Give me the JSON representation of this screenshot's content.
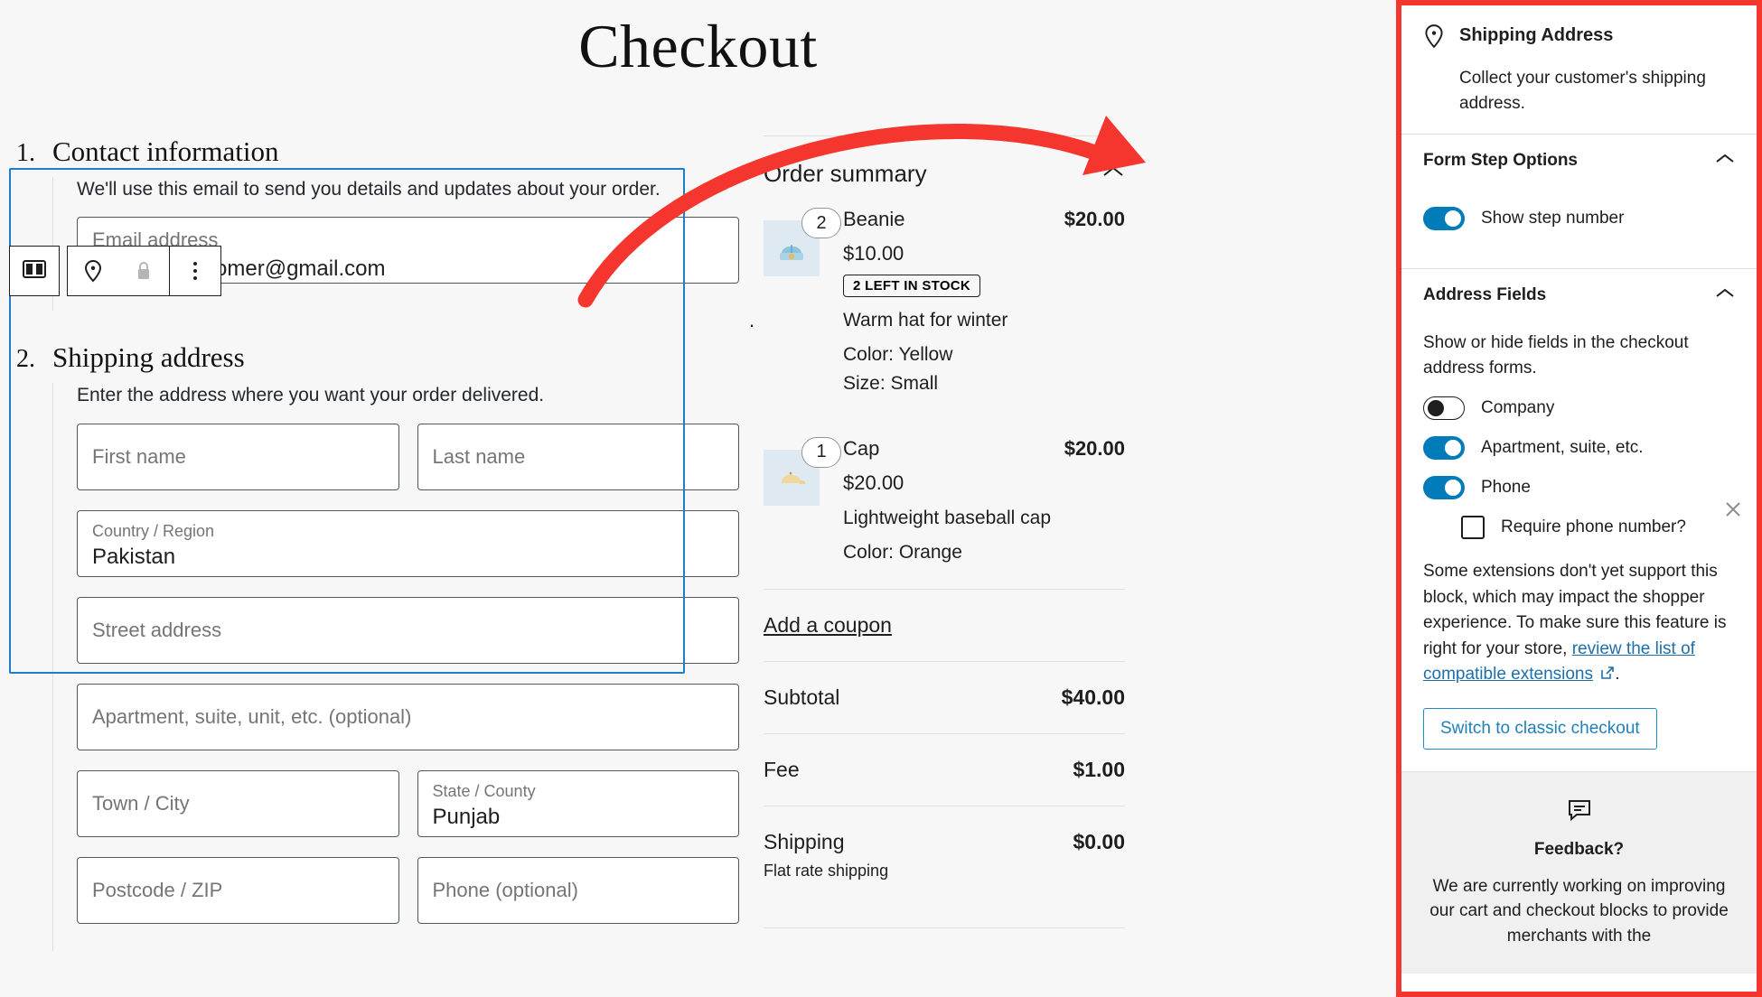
{
  "page": {
    "title": "Checkout"
  },
  "steps": [
    {
      "number": "1.",
      "title": "Contact information",
      "description": "We'll use this email to send you details and updates about your order.",
      "email_label": "Email address",
      "email_value": "surprise.customer@gmail.com"
    },
    {
      "number": "2.",
      "title": "Shipping address",
      "description": "Enter the address where you want your order delivered.",
      "fields": {
        "first_name": "First name",
        "last_name": "Last name",
        "country_label": "Country / Region",
        "country_value": "Pakistan",
        "street": "Street address",
        "apartment": "Apartment, suite, unit, etc. (optional)",
        "city": "Town / City",
        "state_label": "State / County",
        "state_value": "Punjab",
        "postcode": "Postcode / ZIP",
        "phone": "Phone (optional)"
      }
    }
  ],
  "toolbar": {
    "block_icon": "block-layout-icon",
    "location_icon": "map-pin-icon",
    "lock_icon": "lock-icon",
    "more_icon": "more-options-icon"
  },
  "order_summary": {
    "title": "Order summary",
    "collapse_icon": "chevron-up-icon",
    "items": [
      {
        "qty": "2",
        "name": "Beanie",
        "line_total": "$20.00",
        "unit_price": "$10.00",
        "stock_badge": "2 LEFT IN STOCK",
        "description": "Warm hat for winter",
        "attributes": [
          "Color: Yellow",
          "Size: Small"
        ],
        "thumb_icon": "beanie-icon"
      },
      {
        "qty": "1",
        "name": "Cap",
        "line_total": "$20.00",
        "unit_price": "$20.00",
        "stock_badge": "",
        "description": "Lightweight baseball cap",
        "attributes": [
          "Color: Orange"
        ],
        "thumb_icon": "cap-icon"
      }
    ],
    "coupon_link": "Add a coupon",
    "totals": [
      {
        "label": "Subtotal",
        "sub": "",
        "value": "$40.00"
      },
      {
        "label": "Fee",
        "sub": "",
        "value": "$1.00"
      },
      {
        "label": "Shipping",
        "sub": "Flat rate shipping",
        "value": "$0.00"
      }
    ]
  },
  "sidebar": {
    "block": {
      "icon": "map-pin-icon",
      "title": "Shipping Address",
      "description": "Collect your customer's shipping address."
    },
    "form_step_options": {
      "title": "Form Step Options",
      "chevron": "chevron-up-icon",
      "show_step_number": {
        "label": "Show step number",
        "on": true
      }
    },
    "address_fields": {
      "title": "Address Fields",
      "chevron": "chevron-up-icon",
      "helper": "Show or hide fields in the checkout address forms.",
      "toggles": [
        {
          "label": "Company",
          "on": false
        },
        {
          "label": "Apartment, suite, etc.",
          "on": true
        },
        {
          "label": "Phone",
          "on": true
        }
      ],
      "require_phone": {
        "label": "Require phone number?",
        "checked": false
      }
    },
    "notice": {
      "text_before": "Some extensions don't yet support this block, which may impact the shopper experience. To make sure this feature is right for your store, ",
      "link_text": "review the list of compatible extensions",
      "external_icon": "external-link-icon",
      "text_after": ".",
      "close_icon": "close-icon",
      "button_label": "Switch to classic checkout"
    },
    "feedback": {
      "icon": "feedback-comment-icon",
      "title": "Feedback?",
      "text": "We are currently working on improving our cart and checkout blocks to provide merchants with the"
    }
  },
  "annotation": {
    "arrow_color": "#f5362e",
    "highlight_color": "#f5362e"
  }
}
